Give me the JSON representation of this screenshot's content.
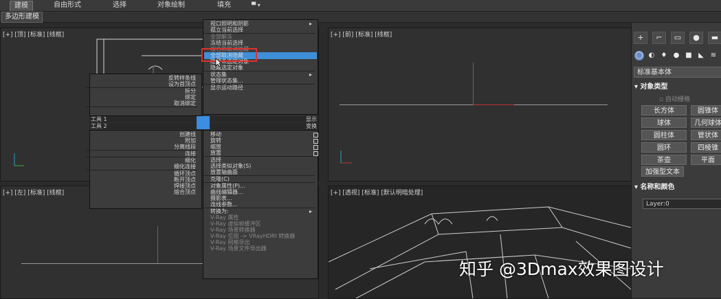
{
  "ribbon": {
    "tabs": [
      "建模",
      "自由形式",
      "选择",
      "对象绘制",
      "填充"
    ],
    "active_tab": "建模",
    "subbar_label": "多边形建模"
  },
  "viewports": {
    "top": "[+] [顶] [标准] [线框]",
    "front": "[+] [前] [标准] [线框]",
    "left": "[+] [左] [标准] [线框]",
    "persp": "[+] [透视] [标准] [默认明暗处理]"
  },
  "quad_menu": {
    "top_right": [
      {
        "label": "视口照明和阴影",
        "arrow": true
      },
      {
        "label": "孤立当前选择"
      },
      {
        "label": "全部解冻",
        "dim": true
      },
      {
        "label": "冻结当前选择",
        "highlighted": true
      },
      {
        "label": "按名称取消隐藏",
        "dim": true
      },
      {
        "label": "全部取消隐藏"
      },
      {
        "label": "隐藏未选定对象"
      },
      {
        "label": "隐藏选定对象"
      },
      {
        "label": "状态集",
        "arrow": true
      },
      {
        "label": "管理状态集..."
      },
      {
        "label": "显示运动路径"
      }
    ],
    "top_left": [
      {
        "label": "反转样条线"
      },
      {
        "label": "设为首顶点"
      },
      {
        "label": "拆分"
      },
      {
        "label": "绑定"
      },
      {
        "label": "取消绑定"
      }
    ],
    "header_left_1": "工具 1",
    "header_right_1": "显示",
    "header_left_2": "工具 2",
    "header_right_2": "变换",
    "bottom_left": [
      {
        "label": "创建线"
      },
      {
        "label": "附加"
      },
      {
        "label": "分离线段"
      },
      {
        "label": "连接"
      },
      {
        "label": "细化"
      },
      {
        "label": "细化连接"
      },
      {
        "label": "循环顶点"
      },
      {
        "label": "断开顶点"
      },
      {
        "label": "焊接顶点"
      },
      {
        "label": "熔合顶点"
      }
    ],
    "bottom_right": [
      {
        "label": "移动"
      },
      {
        "label": "旋转"
      },
      {
        "label": "缩放"
      },
      {
        "label": "放置"
      },
      {
        "label": "选择"
      },
      {
        "label": "选择类似对象(S)"
      },
      {
        "label": "放置轴曲面"
      },
      {
        "label": "克隆(C)"
      },
      {
        "label": "对象属性(P)..."
      },
      {
        "label": "曲线编辑器..."
      },
      {
        "label": "摄影表..."
      },
      {
        "label": "连线参数..."
      },
      {
        "label": "转换为:",
        "arrow": true
      },
      {
        "label": "V-Ray 属性",
        "dim": true
      },
      {
        "label": "V-Ray 虚拟帧缓冲区",
        "dim": true
      },
      {
        "label": "V-Ray 场景转换器",
        "dim": true
      },
      {
        "label": "V-Ray 位图 -> VRayHDRI 转换器",
        "dim": true
      },
      {
        "label": "V-Ray 网格导出",
        "dim": true
      },
      {
        "label": "V-Ray 场景文件导出器",
        "dim": true
      }
    ]
  },
  "command_panel": {
    "tab_icons": [
      "+",
      "⌐",
      "▭",
      "●",
      "▬",
      "🔧"
    ],
    "sub_icons": [
      "◯",
      "◐",
      "♦",
      "●",
      "■",
      "◣",
      "≋"
    ],
    "category": "标准基本体",
    "object_type_title": "对象类型",
    "autogrid": "自动栅格",
    "buttons": [
      "长方体",
      "圆锥体",
      "球体",
      "几何球体",
      "圆柱体",
      "管状体",
      "圆环",
      "四棱锥",
      "茶壶",
      "平面",
      "加强型文本"
    ],
    "name_color_title": "名称和颜色",
    "name_value": "Layer:0"
  },
  "watermark": "知乎 @3Dmax效果图设计",
  "colors": {
    "highlight": "#3f8fd8",
    "callout": "#e03030",
    "axis_x": "#c83030"
  }
}
